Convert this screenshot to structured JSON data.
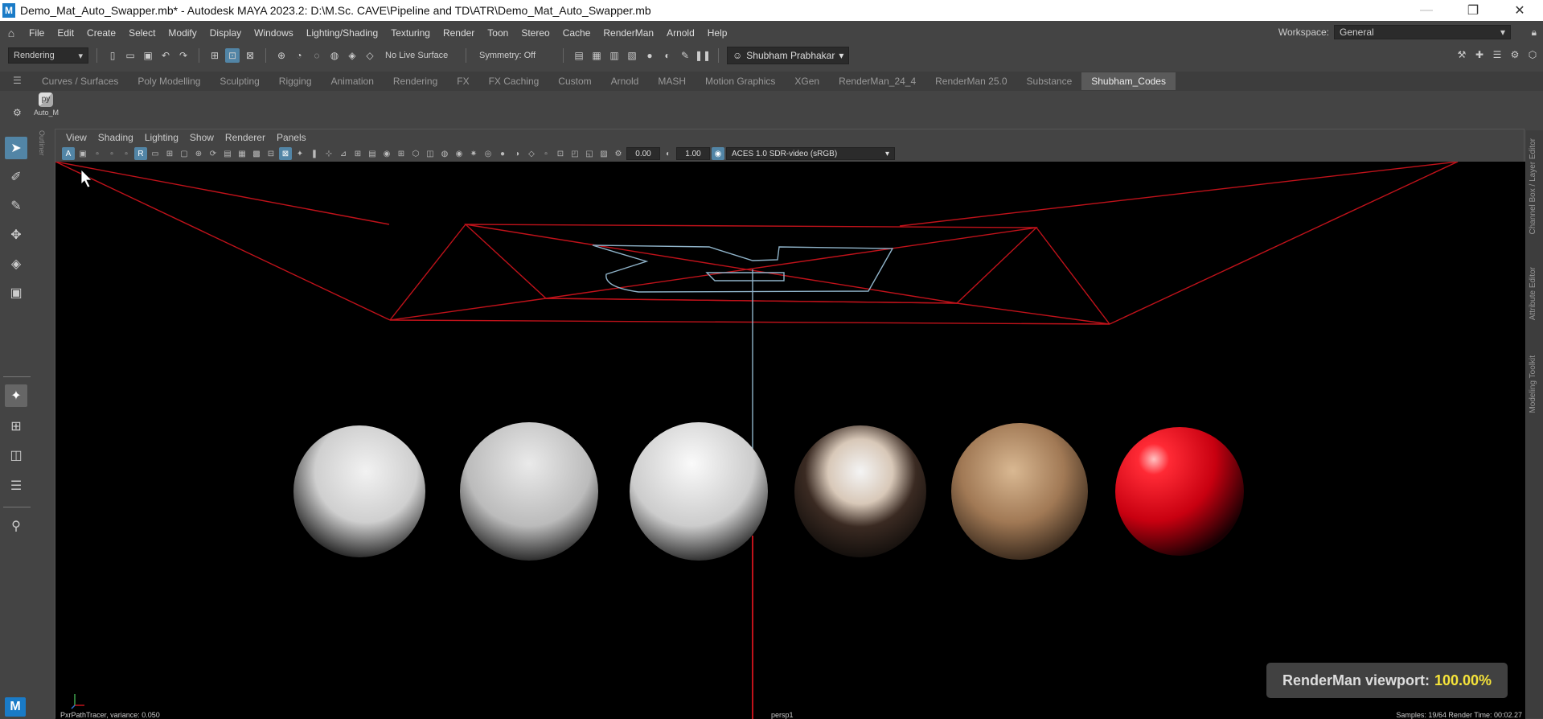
{
  "window": {
    "title": "Demo_Mat_Auto_Swapper.mb* - Autodesk MAYA 2023.2: D:\\M.Sc. CAVE\\Pipeline and TD\\ATR\\Demo_Mat_Auto_Swapper.mb",
    "app_icon": "M",
    "minimize": "—",
    "restore": "❐",
    "close": "✕"
  },
  "menubar": {
    "items": [
      "File",
      "Edit",
      "Create",
      "Select",
      "Modify",
      "Display",
      "Windows",
      "Lighting/Shading",
      "Texturing",
      "Render",
      "Toon",
      "Stereo",
      "Cache",
      "RenderMan",
      "Arnold",
      "Help"
    ],
    "workspace_label": "Workspace:",
    "workspace_value": "General"
  },
  "statusline": {
    "menuset": "Rendering",
    "live_surface": "No Live Surface",
    "symmetry": "Symmetry: Off",
    "user": "Shubham Prabhakar"
  },
  "shelf_tabs": [
    "Curves / Surfaces",
    "Poly Modelling",
    "Sculpting",
    "Rigging",
    "Animation",
    "Rendering",
    "FX",
    "FX Caching",
    "Custom",
    "Arnold",
    "MASH",
    "Motion Graphics",
    "XGen",
    "RenderMan_24_4",
    "RenderMan 25.0",
    "Substance",
    "Shubham_Codes"
  ],
  "active_shelf_tab": "Shubham_Codes",
  "shelf": {
    "item_label": "Auto_M"
  },
  "outliner_tab": "Outliner",
  "panel_menu": [
    "View",
    "Shading",
    "Lighting",
    "Show",
    "Renderer",
    "Panels"
  ],
  "panel_toolbar": {
    "exposure": "0.00",
    "gamma": "1.00",
    "color_space": "ACES 1.0 SDR-video (sRGB)"
  },
  "right_tabs": [
    "Channel Box / Layer Editor",
    "Attribute Editor",
    "Modeling Toolkit"
  ],
  "viewport": {
    "overlay_label": "RenderMan viewport:",
    "overlay_percent": "100.00%",
    "status_left": "PxrPathTracer, variance: 0.050",
    "camera": "persp1",
    "status_right": "Samples: 19/64  Render Time: 00:02.27",
    "progress": 1.0
  },
  "colors": {
    "accent": "#5285a6",
    "maya_blue": "#1a7bc7",
    "overlay_yellow": "#f5e33a",
    "wire_red": "#c0121a",
    "wire_blue": "#8fb3c9"
  }
}
